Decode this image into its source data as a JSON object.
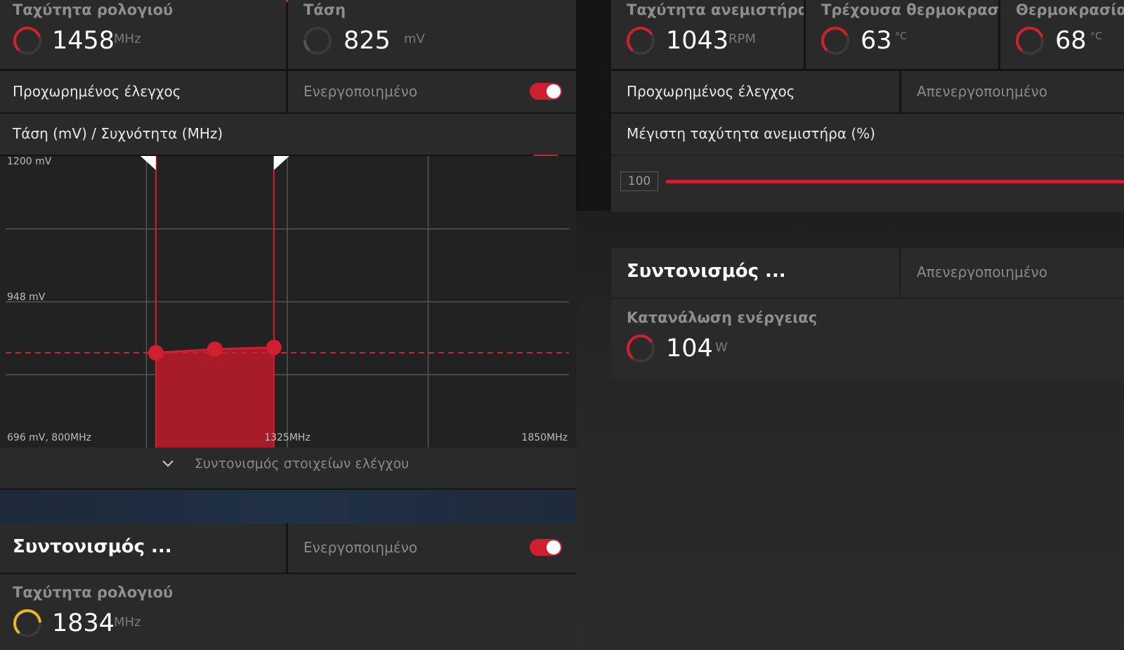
{
  "left": {
    "metrics": [
      {
        "title": "Ταχύτητα ρολογιού",
        "value": "1458",
        "unit": "MHz",
        "gauge_color": "#d0202f",
        "gauge_level": 0.75
      },
      {
        "title": "Τάση",
        "value": "825",
        "unit": "mV",
        "gauge_color": "#555555",
        "gauge_level": 0.15
      }
    ],
    "advanced_control": {
      "label": "Προχωρημένος έλεγχος",
      "value": "Ενεργοποιημένο",
      "enabled": true
    },
    "curve_header": "Τάση (mV) / Συχνότητα (MHz)",
    "expand_label": "Συντονισμός στοιχείων ελέγχου",
    "tuning": {
      "title": "Συντονισμός ...",
      "value": "Ενεργοποιημένο",
      "enabled": true
    },
    "clock": {
      "title": "Ταχύτητα ρολογιού",
      "value": "1834",
      "unit": "MHz",
      "gauge_color": "#e8b923",
      "gauge_level": 0.8
    }
  },
  "right": {
    "metrics": [
      {
        "title": "Ταχύτητα ανεμιστήρα",
        "value": "1043",
        "unit": "RPM",
        "gauge_color": "#d0202f",
        "gauge_level": 0.7
      },
      {
        "title": "Τρέχουσα θερμοκρασία",
        "value": "63",
        "unit": "°C",
        "gauge_color": "#d0202f",
        "gauge_level": 0.72
      },
      {
        "title": "Θερμοκρασία ε",
        "value": "68",
        "unit": "°C",
        "gauge_color": "#d0202f",
        "gauge_level": 0.75
      }
    ],
    "advanced_control": {
      "label": "Προχωρημένος έλεγχος",
      "value": "Απενεργοποιημένο"
    },
    "fan_max": {
      "label": "Μέγιστη ταχύτητα ανεμιστήρα (%)",
      "value": "100"
    },
    "tuning": {
      "title": "Συντονισμός ...",
      "value": "Απενεργοποιημένο"
    },
    "power": {
      "title": "Κατανάλωση ενέργειας",
      "value": "104",
      "unit": "W",
      "gauge_color": "#d0202f",
      "gauge_level": 0.7
    }
  },
  "chart_data": {
    "type": "line",
    "x_range": [
      800,
      1850
    ],
    "y_range": [
      696,
      1200
    ],
    "x_ticks": [
      "696 mV, 800MHz",
      "1325MHz",
      "1850MHz"
    ],
    "y_ticks": [
      "1200 mV",
      "948 mV"
    ],
    "points": [
      {
        "x": 1080,
        "y": 860
      },
      {
        "x": 1190,
        "y": 866
      },
      {
        "x": 1300,
        "y": 869
      }
    ],
    "reference_line_y": 860,
    "handles_x": [
      1080,
      1300
    ],
    "accent": "#d0202f"
  }
}
